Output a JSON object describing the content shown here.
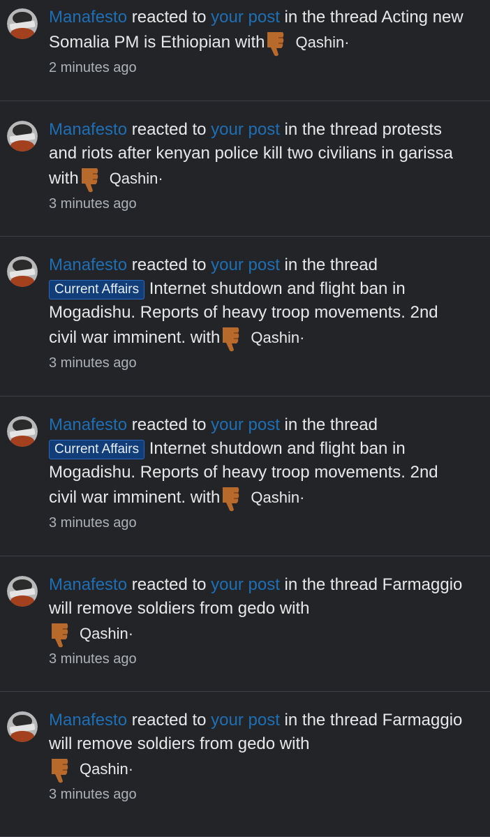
{
  "notifications": [
    {
      "user": "Manafesto",
      "pre": "reacted to",
      "post": "your post",
      "mid": "in the thread",
      "tag": "",
      "title": "Acting new Somalia PM is Ethiopian",
      "with": "with",
      "reaction": "Qashin",
      "time": "2 minutes ago"
    },
    {
      "user": "Manafesto",
      "pre": "reacted to",
      "post": "your post",
      "mid": "in the thread",
      "tag": "",
      "title": "protests and riots after kenyan police kill two civilians in garissa",
      "with": "with",
      "reaction": "Qashin",
      "time": "3 minutes ago"
    },
    {
      "user": "Manafesto",
      "pre": "reacted to",
      "post": "your post",
      "mid": "in the thread",
      "tag": "Current Affairs",
      "title": "Internet shutdown and flight ban in Mogadishu. Reports of heavy troop movements. 2nd civil war imminent.",
      "with": "with",
      "reaction": "Qashin",
      "time": "3 minutes ago"
    },
    {
      "user": "Manafesto",
      "pre": "reacted to",
      "post": "your post",
      "mid": "in the thread",
      "tag": "Current Affairs",
      "title": "Internet shutdown and flight ban in Mogadishu. Reports of heavy troop movements. 2nd civil war imminent.",
      "with": "with",
      "reaction": "Qashin",
      "time": "3 minutes ago"
    },
    {
      "user": "Manafesto",
      "pre": "reacted to",
      "post": "your post",
      "mid": "in the thread",
      "tag": "",
      "title": "Farmaggio will remove soldiers from gedo",
      "with": "with",
      "reaction": "Qashin",
      "time": "3 minutes ago"
    },
    {
      "user": "Manafesto",
      "pre": "reacted to",
      "post": "your post",
      "mid": "in the thread",
      "tag": "",
      "title": "Farmaggio will remove soldiers from gedo",
      "with": "with",
      "reaction": "Qashin",
      "time": "3 minutes ago"
    }
  ],
  "colors": {
    "background": "#222428",
    "link": "#1f6fb5",
    "tag_bg": "#113d78",
    "divider": "#3d4046",
    "muted": "#aeb1b6"
  },
  "icons": {
    "avatar": "avatar-image",
    "reaction": "thumbs-down-icon"
  }
}
